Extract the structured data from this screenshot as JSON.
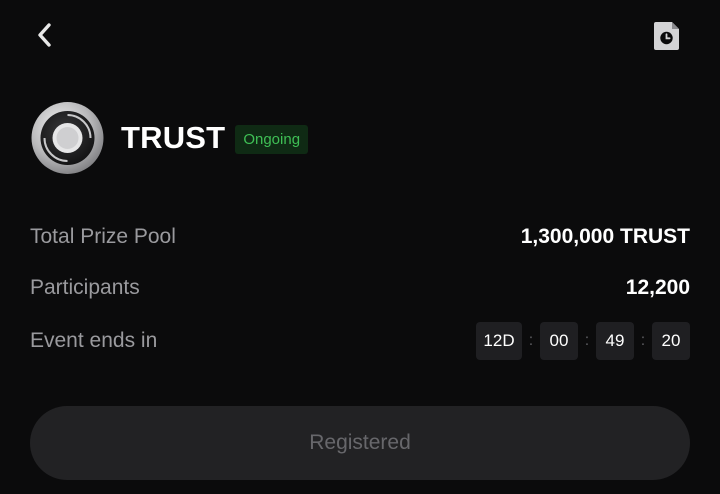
{
  "header": {
    "back_icon": "chevron-left-icon",
    "history_icon": "clock-document-icon"
  },
  "token": {
    "name": "TRUST",
    "status": "Ongoing",
    "status_color": "#3fbf55",
    "logo_icon": "trust-coin-icon"
  },
  "info": {
    "prize_pool_label": "Total Prize Pool",
    "prize_pool_value": "1,300,000 TRUST",
    "participants_label": "Participants",
    "participants_value": "12,200",
    "event_ends_label": "Event ends in"
  },
  "countdown": {
    "days": "12D",
    "hours": "00",
    "minutes": "49",
    "seconds": "20",
    "separator": ":"
  },
  "action": {
    "register_label": "Registered"
  }
}
